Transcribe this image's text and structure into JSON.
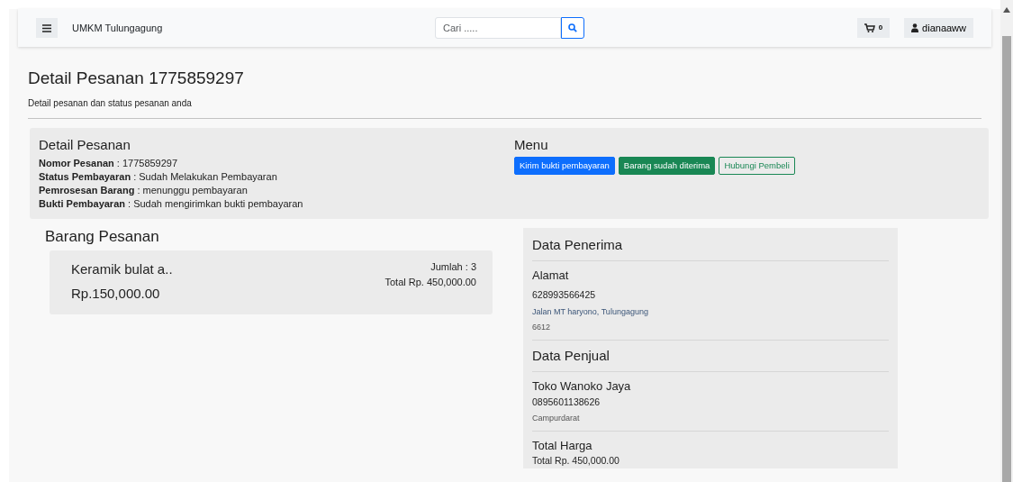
{
  "navbar": {
    "brand": "UMKM Tulungagung",
    "search": {
      "placeholder": "Cari ....."
    },
    "cart_count": "0",
    "user": "dianaaww"
  },
  "page": {
    "title": "Detail Pesanan 1775859297",
    "subtitle": "Detail pesanan dan status pesanan anda"
  },
  "detail": {
    "title": "Detail Pesanan",
    "fields": [
      {
        "text": "**Nomor Pesanan** : 1775859297"
      },
      {
        "text": "**Status Pembayaran** : Sudah Melakukan Pembayaran"
      },
      {
        "text": "**Pemrosesan Barang** : menunggu pembayaran"
      },
      {
        "text": "**Bukti Pembayaran** : Sudah mengirimkan bukti pembayaran"
      }
    ]
  },
  "menu": {
    "title": "Menu",
    "buttons": [
      {
        "label": "Kirim bukti pembayaran",
        "kind": "primary"
      },
      {
        "label": "Barang sudah diterima",
        "kind": "success"
      },
      {
        "label": "Hubungi Pembeli",
        "kind": "outline"
      }
    ]
  },
  "items": {
    "title": "Barang Pesanan",
    "list": [
      {
        "name": "Keramik bulat a..",
        "price": "Rp.150,000.00",
        "quantity": "Jumlah : 3",
        "total": "Total Rp. 450,000.00"
      }
    ]
  },
  "recipient": {
    "title": "Data Penerima",
    "address_title": "Alamat",
    "phone": "628993566425",
    "address": "Jalan MT haryono, Tulungagung",
    "postal_code": "6612"
  },
  "seller": {
    "title": "Data Penjual",
    "name": "Toko Wanoko Jaya",
    "phone": "0895601138626",
    "city": "Campurdarat"
  },
  "total": {
    "title": "Total Harga",
    "value": "Total Rp. 450,000.00"
  }
}
